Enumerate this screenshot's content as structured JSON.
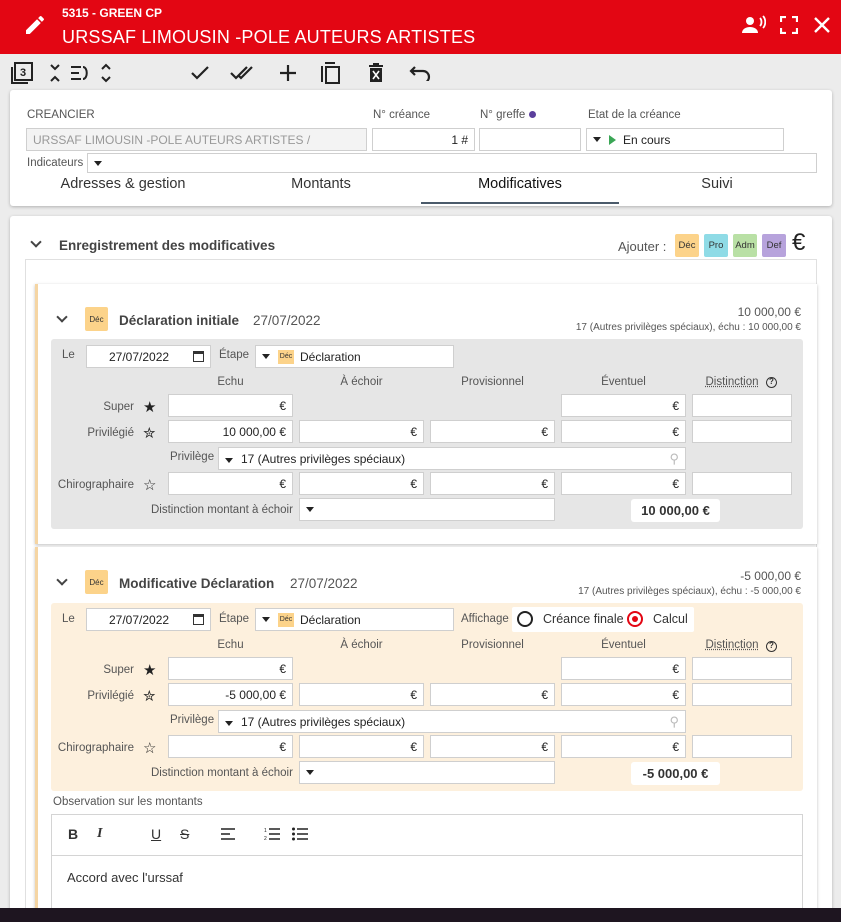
{
  "header": {
    "subtitle": "5315 - GREEN CP",
    "title": "URSSAF LIMOUSIN -POLE AUTEURS ARTISTES"
  },
  "toolbar": {
    "page_badge": "3"
  },
  "creditor": {
    "creancier_label": "CREANCIER",
    "creancier_value": "URSSAF LIMOUSIN -POLE AUTEURS ARTISTES /",
    "creance_label": "N° créance",
    "creance_value": "1 #",
    "greffe_label": "N° greffe",
    "etat_label": "Etat de la créance",
    "etat_value": "En cours",
    "indicateurs_label": "Indicateurs"
  },
  "tabs": [
    "Adresses & gestion",
    "Montants",
    "Modificatives",
    "Suivi"
  ],
  "main": {
    "section_title": "Enregistrement des modificatives",
    "add_label": "Ajouter :",
    "add_types": [
      {
        "label": "Déc",
        "color": "#fcd38a"
      },
      {
        "label": "Pro",
        "color": "#8fdbe6"
      },
      {
        "label": "Adm",
        "color": "#b9e0a5"
      },
      {
        "label": "Def",
        "color": "#b7a3dc"
      }
    ],
    "euro_symbol": "€"
  },
  "columns": {
    "echu": "Echu",
    "aechoir": "À échoir",
    "provisionnel": "Provisionnel",
    "eventuel": "Éventuel",
    "distinction": "Distinction"
  },
  "rows": {
    "super": "Super",
    "privilegie": "Privilégié",
    "privilege": "Privilège",
    "chirographaire": "Chirographaire",
    "distinction_montant": "Distinction montant à échoir"
  },
  "common": {
    "le": "Le",
    "etape": "Étape",
    "dec": "Déc",
    "euro": "€"
  },
  "card1": {
    "title": "Déclaration initiale",
    "date": "27/07/2022",
    "amount": "10 000,00 €",
    "detail": "17 (Autres privilèges spéciaux), échu : 10 000,00 €",
    "le_value": "27/07/2022",
    "etape_value": "Déclaration",
    "privilegie_echu": "10 000,00 €",
    "privilege_value": "17 (Autres privilèges spéciaux)",
    "total": "10 000,00 €"
  },
  "card2": {
    "title": "Modificative Déclaration",
    "date": "27/07/2022",
    "amount": "-5 000,00 €",
    "detail": "17 (Autres privilèges spéciaux), échu : -5 000,00 €",
    "le_value": "27/07/2022",
    "etape_value": "Déclaration",
    "affichage_label": "Affichage",
    "creance_finale": "Créance finale",
    "calcul": "Calcul",
    "privilegie_echu": "-5 000,00 €",
    "privilege_value": "17 (Autres privilèges spéciaux)",
    "total": "-5 000,00 €",
    "observation_label": "Observation sur les montants",
    "observation_text": "Accord avec l'urssaf"
  }
}
